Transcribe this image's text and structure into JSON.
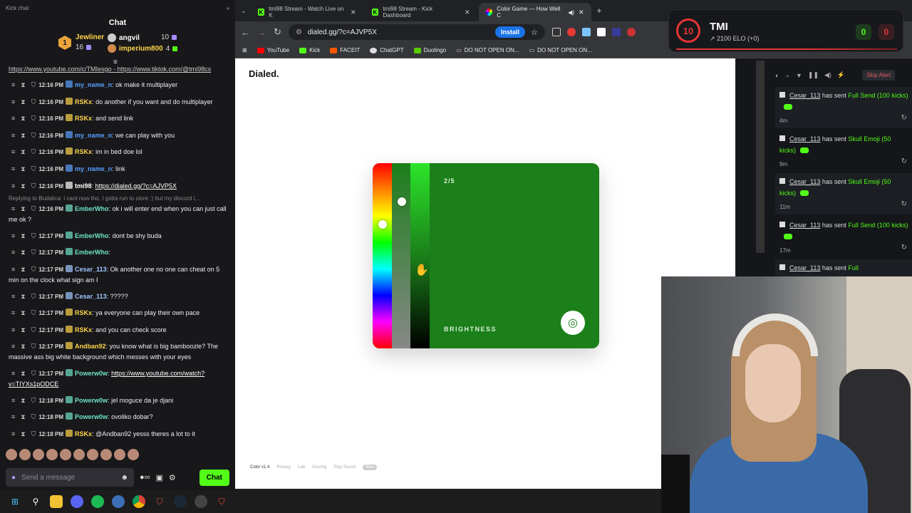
{
  "chat": {
    "top_label": "Kick chat",
    "title": "Chat",
    "leaderboard": [
      {
        "rank": "1",
        "name": "Jewliner",
        "count": "16"
      },
      {
        "rank": "",
        "name": "angvil",
        "count": "10"
      },
      {
        "rank": "",
        "name": "imperium800",
        "count": "4"
      }
    ],
    "cut_line": "https://www.youtube.com/c/TMIesgo - https://www.tiktok.com/@tmi98cs",
    "messages": [
      {
        "time": "12:16 PM",
        "user": "my_name_n",
        "color": "#5aa0ff",
        "text": ": ok make it multiplayer"
      },
      {
        "time": "12:16 PM",
        "user": "RSKx",
        "color": "#ffd54a",
        "text": ": do another if you want and do multiplayer"
      },
      {
        "time": "12:16 PM",
        "user": "RSKx",
        "color": "#ffd54a",
        "text": ": and send link"
      },
      {
        "time": "12:16 PM",
        "user": "my_name_n",
        "color": "#5aa0ff",
        "text": ": we can play with you"
      },
      {
        "time": "12:16 PM",
        "user": "RSKx",
        "color": "#ffd54a",
        "text": ": im in bed doe lol"
      },
      {
        "time": "12:16 PM",
        "user": "my_name_n",
        "color": "#5aa0ff",
        "text": ": link"
      },
      {
        "time": "12:16 PM",
        "user": "tmi98",
        "color": "#ffffff",
        "text": ": ",
        "link": "https://dialed.gg/?c=AJVP5X"
      },
      {
        "reply": "Replying to Budalica: i cant now tho, I gotta run to store :) but my discord i..."
      },
      {
        "time": "12:16 PM",
        "user": "EmberWho",
        "color": "#6fe3c8",
        "text": ": ok i will enter end when you can just call me ok ?"
      },
      {
        "time": "12:17 PM",
        "user": "EmberWho",
        "color": "#6fe3c8",
        "text": ": dont be shy buda"
      },
      {
        "time": "12:17 PM",
        "user": "EmberWho",
        "color": "#6fe3c8",
        "text": ":"
      },
      {
        "time": "12:17 PM",
        "user": "Cesar_113",
        "color": "#9fc7ff",
        "text": ": Ok another one no one can cheat on 5 min on the clock what sign am I"
      },
      {
        "time": "12:17 PM",
        "user": "Cesar_113",
        "color": "#9fc7ff",
        "text": ": ?????"
      },
      {
        "time": "12:17 PM",
        "user": "RSKx",
        "color": "#ffd54a",
        "text": ": ya everyone can play their own pace"
      },
      {
        "time": "12:17 PM",
        "user": "RSKx",
        "color": "#ffd54a",
        "text": ": and you can check score"
      },
      {
        "time": "12:17 PM",
        "user": "Andban92",
        "color": "#ffd54a",
        "text": ": you know what is big bamboozle? The massive ass big white background which messes with your eyes"
      },
      {
        "time": "12:17 PM",
        "user": "Powerw0w",
        "color": "#6fe3c8",
        "text": ": ",
        "link": "https://www.youtube.com/watch?v=TIYXs1pODCE"
      },
      {
        "time": "12:18 PM",
        "user": "Powerw0w",
        "color": "#6fe3c8",
        "text": ": jel moguce da je djani"
      },
      {
        "time": "12:18 PM",
        "user": "Powerw0w",
        "color": "#6fe3c8",
        "text": ": ovoliko dobar?"
      },
      {
        "time": "12:18 PM",
        "user": "RSKx",
        "color": "#ffd54a",
        "text": ": @Andban92 yesss theres a lot to it"
      }
    ],
    "input_placeholder": "Send a message",
    "send_label": "Chat"
  },
  "browser": {
    "tabs": [
      {
        "label": "tmi98 Stream - Watch Live on K",
        "fav": "kick"
      },
      {
        "label": "tmi98 Stream - Kick Dashboard",
        "fav": "kick"
      },
      {
        "label": "Color Game — How Well C",
        "fav": "color",
        "active": true
      }
    ],
    "url": "dialed.gg/?c=AJVP5X",
    "install_label": "Install",
    "bookmarks": [
      "YouTube",
      "Kick",
      "FACEIT",
      "ChatGPT",
      "Duolingo",
      "DO NOT OPEN ON...",
      "DO NOT OPEN ON..."
    ]
  },
  "game": {
    "brand": "Dialed.",
    "step": "2/5",
    "slider_label": "BRIGHTNESS",
    "colors": {
      "target": "#1b7f1a",
      "accent": "#53fc18"
    },
    "footer": {
      "version": "Color v1.4",
      "links": [
        "Privacy",
        "Lab",
        "Scoring",
        "Play Sound"
      ],
      "badge": "New"
    }
  },
  "alerts": {
    "skip_label": "Skip Alert",
    "items": [
      {
        "name": "Cesar_113",
        "pre": " has sent ",
        "gift": "Full Send (100 kicks)",
        "time": "4m"
      },
      {
        "name": "Cesar_113",
        "pre": " has sent ",
        "gift": "Skull Emoji (50 kicks)",
        "time": "9m"
      },
      {
        "name": "Cesar_113",
        "pre": " has sent ",
        "gift": "Skull Emoji (50 kicks)",
        "time": "11m"
      },
      {
        "name": "Cesar_113",
        "pre": " has sent ",
        "gift": "Full Send (100 kicks)",
        "time": "17m"
      },
      {
        "name": "Cesar_113",
        "pre": " has sent ",
        "gift": "Full",
        "time": ""
      }
    ]
  },
  "overlay": {
    "level": "10",
    "name": "TMI",
    "elo": "2100 ELO (+0)",
    "score_left": "0",
    "score_right": "0"
  }
}
